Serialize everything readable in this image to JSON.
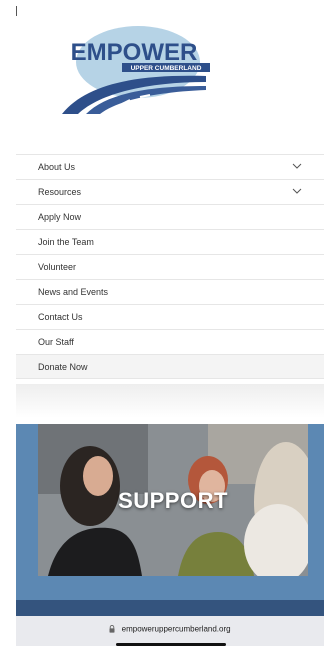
{
  "brand": {
    "name": "EMPOWER",
    "tagline": "UPPER CUMBERLAND",
    "colors": {
      "navy": "#2e4f8a",
      "sky": "#b6d3e6",
      "road": "#3a5d99"
    }
  },
  "menu": {
    "items": [
      {
        "label": "About Us",
        "has_submenu": true,
        "icon": "chevron-down-icon"
      },
      {
        "label": "Resources",
        "has_submenu": true,
        "icon": "chevron-down-icon"
      },
      {
        "label": "Apply Now",
        "has_submenu": false
      },
      {
        "label": "Join the Team",
        "has_submenu": false
      },
      {
        "label": "Volunteer",
        "has_submenu": false
      },
      {
        "label": "News and Events",
        "has_submenu": false
      },
      {
        "label": "Contact Us",
        "has_submenu": false
      },
      {
        "label": "Our Staff",
        "has_submenu": false
      },
      {
        "label": "Donate Now",
        "has_submenu": false
      }
    ]
  },
  "hero": {
    "title": "SUPPORT",
    "colors": {
      "panel": "#5c88b3",
      "band": "#34547e"
    }
  },
  "browser": {
    "url": "empoweruppercumberland.org",
    "icon": "lock-icon"
  }
}
